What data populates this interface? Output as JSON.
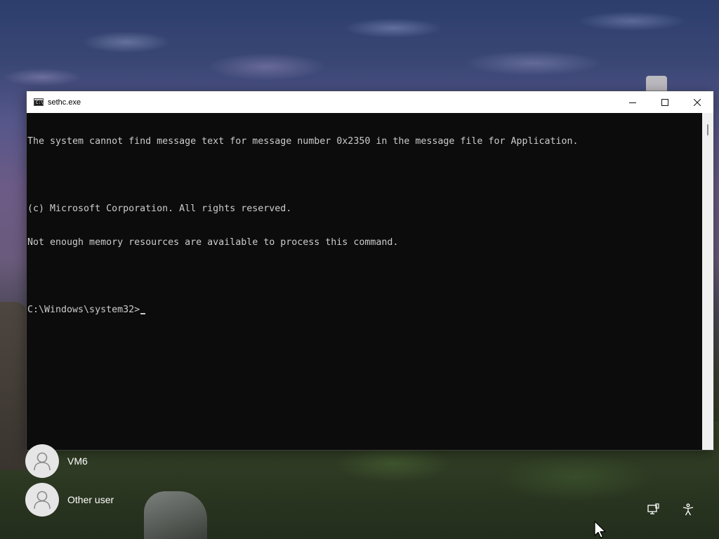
{
  "window": {
    "title": "sethc.exe",
    "icon": "console-icon",
    "icon_text": "C:\\",
    "buttons": [
      "minimize-icon",
      "maximize-icon",
      "close-icon"
    ]
  },
  "console": {
    "lines": [
      "The system cannot find message text for message number 0x2350 in the message file for Application.",
      "",
      "(c) Microsoft Corporation. All rights reserved.",
      "Not enough memory resources are available to process this command.",
      ""
    ],
    "prompt": "C:\\Windows\\system32>"
  },
  "users": [
    {
      "name": "VM6",
      "icon": "user-icon"
    },
    {
      "name": "Other user",
      "icon": "user-icon"
    }
  ],
  "tray": {
    "network_icon": "network-icon",
    "accessibility_icon": "accessibility-icon"
  },
  "colors": {
    "console_bg": "#0c0c0c",
    "console_fg": "#cccccc",
    "titlebar_bg": "#ffffff",
    "avatar_bg": "#e6e6e6"
  }
}
